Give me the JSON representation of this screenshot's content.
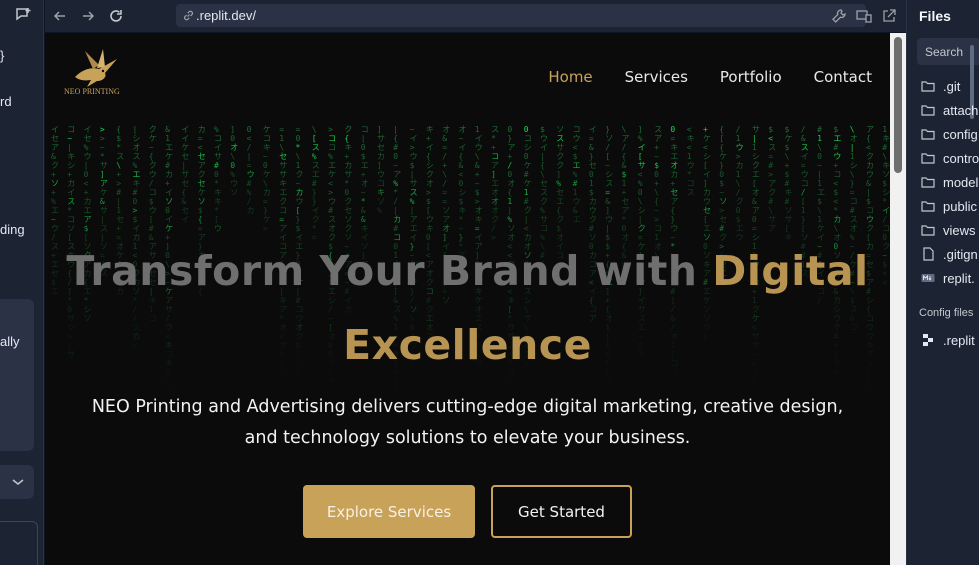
{
  "chat_panel": {
    "fragments": [
      "}",
      "rd",
      "ding",
      "ally"
    ]
  },
  "browser": {
    "url": ".replit.dev/"
  },
  "site": {
    "logo_text": "NEO PRINTING",
    "nav": [
      "Home",
      "Services",
      "Portfolio",
      "Contact"
    ],
    "active_nav": "Home",
    "hero": {
      "title_part1": "Transform Your Brand with ",
      "title_highlight1": "Digital",
      "title_highlight2": "Excellence",
      "subtitle": "NEO Printing and Advertising delivers cutting-edge digital marketing, creative design, and technology solutions to elevate your business.",
      "primary_button": "Explore Services",
      "secondary_button": "Get Started"
    }
  },
  "files_panel": {
    "title": "Files",
    "search_placeholder": "Search",
    "items": [
      ".git",
      "attach",
      "config",
      "contro",
      "model",
      "public",
      "views",
      ".gitign",
      "replit."
    ],
    "config_title": "Config files",
    "config_items": [
      ".replit"
    ]
  },
  "colors": {
    "accent_gold": "#c9a25a",
    "matrix_green": "#1fd655",
    "ide_bg": "#1c2333"
  }
}
